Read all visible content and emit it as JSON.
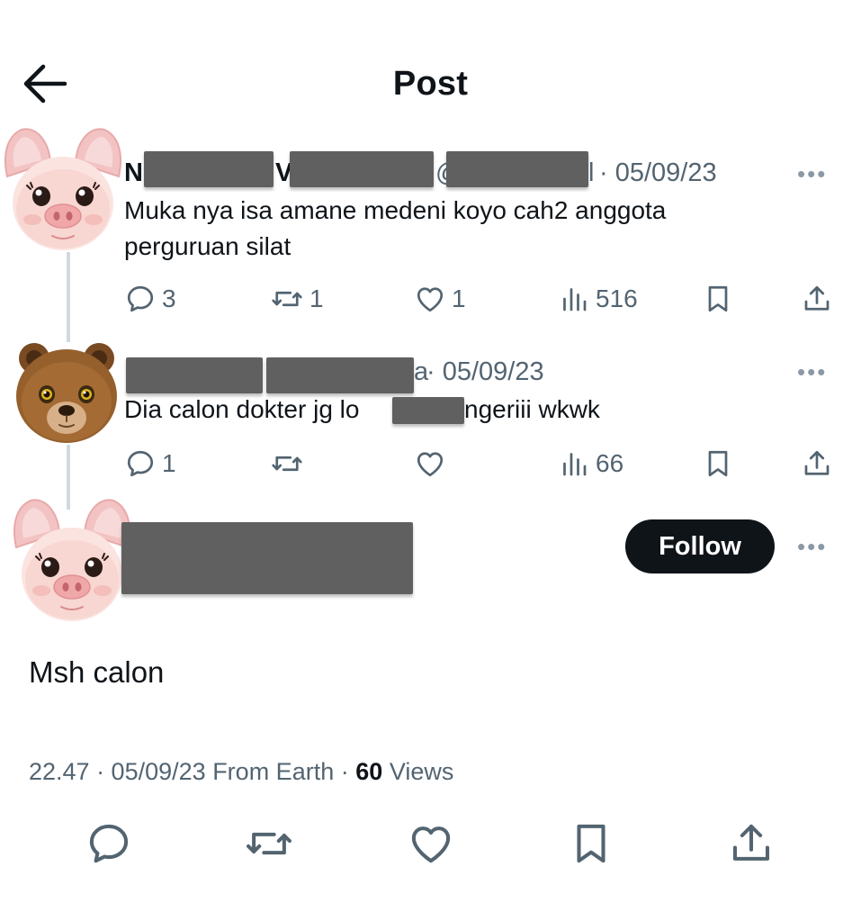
{
  "header": {
    "title": "Post"
  },
  "thread": [
    {
      "name_visible_start": "N",
      "name_visible_mid": "V",
      "handle_visible_start": "@",
      "handle_visible_end": "l",
      "date": "· 05/09/23",
      "text_line1": "Muka nya isa amane medeni koyo cah2 anggota",
      "text_line2": "perguruan silat",
      "replies": "3",
      "reposts": "1",
      "likes": "1",
      "views": "516",
      "more": "•••"
    },
    {
      "handle_visible_start": "@",
      "handle_visible_end": "a",
      "date": "· 05/09/23",
      "text_start": "Dia calon dokter jg lo",
      "text_end": "ngeriii wkwk",
      "replies": "1",
      "views": "66",
      "more": "•••"
    }
  ],
  "main_post": {
    "follow_label": "Follow",
    "more": "•••",
    "text": "Msh calon",
    "time_date": "22.47 · 05/09/23",
    "source": "From Earth",
    "separator": "·",
    "views_count": "60",
    "views_label": "Views"
  },
  "icons": {
    "back": "arrow-left-icon",
    "reply": "speech-bubble-icon",
    "repost": "repost-arrows-icon",
    "like": "heart-icon",
    "views": "bar-chart-icon",
    "bookmark": "bookmark-icon",
    "share": "share-upload-icon",
    "avatar_pig": "pig-emoji-avatar",
    "avatar_bear": "bear-emoji-avatar"
  },
  "colors": {
    "text_primary": "#0f1419",
    "text_secondary": "#536471",
    "thread_line": "#cfd9de",
    "follow_bg": "#0f1419",
    "redaction": "#606060"
  }
}
